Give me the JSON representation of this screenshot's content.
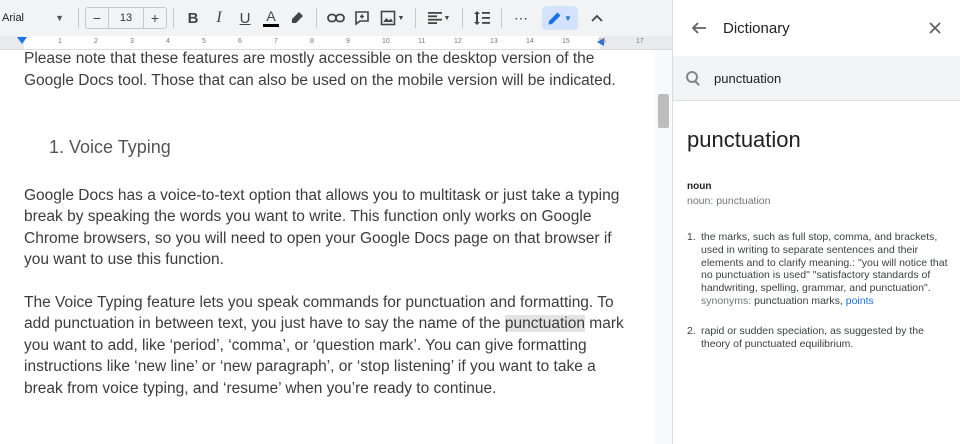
{
  "toolbar": {
    "font_name": "Arial",
    "font_size": "13",
    "minus_label": "−",
    "plus_label": "+",
    "bold_label": "B",
    "italic_label": "I",
    "underline_label": "U",
    "text_color_label": "A",
    "more_label": "⋯",
    "icons": [
      "chevron-down-icon",
      "highlighter-icon",
      "link-icon",
      "comment-icon",
      "image-icon",
      "align-icon",
      "line-spacing-icon",
      "more-icon",
      "pencil-icon",
      "chevron-up-icon"
    ]
  },
  "ruler": {
    "ticks": [
      "1",
      "2",
      "3",
      "4",
      "5",
      "6",
      "7",
      "8",
      "9",
      "10",
      "11",
      "12",
      "13",
      "14",
      "15",
      "16",
      "17"
    ]
  },
  "document": {
    "para0": "Please note that these features are mostly accessible on the desktop version of the Google Docs tool. Those that can also be used on the mobile version will be indicated.",
    "heading": "1.  Voice Typing",
    "para1": "Google Docs has a voice-to-text option that allows you to multitask or just take a typing break by speaking the words you want to write. This function only works on Google Chrome browsers, so you will need to open your Google Docs page on that browser if you want to use this function.",
    "para2_before": "The Voice Typing feature lets you speak commands for punctuation and formatting. To add punctuation in between text, you just have to say the name of the ",
    "para2_highlight": "punctuation",
    "para2_after": " mark you want to add, like  ‘period’, ‘comma’, or ‘question mark’. You can give formatting instructions like ‘new line’ or ‘new paragraph’, or ‘stop listening’ if you want to take a break from voice typing, and ‘resume’ when you’re ready to continue."
  },
  "dictionary": {
    "title": "Dictionary",
    "back_icon": "arrow-left-icon",
    "close_icon": "close-icon",
    "search_value": "punctuation",
    "word": "punctuation",
    "part_of_speech": "noun",
    "pos_sub": "noun: punctuation",
    "definitions": [
      {
        "num": "1.",
        "text": "the marks, such as full stop, comma, and brackets, used in writing to separate sentences and their elements and to clarify meaning.: \"you will notice that no punctuation is used\" \"satisfactory standards of handwriting, spelling, grammar, and punctuation\".",
        "synonyms_label": "synonyms:",
        "synonyms_text": "punctuation marks,",
        "synonyms_link": "points"
      },
      {
        "num": "2.",
        "text": "rapid or sudden speciation, as suggested by the theory of punctuated equilibrium."
      }
    ]
  }
}
